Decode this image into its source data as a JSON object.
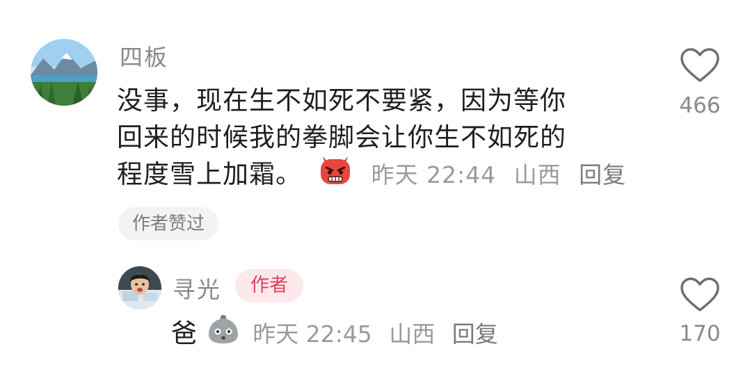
{
  "comment": {
    "username": "四板",
    "lines": [
      "没事，现在生不如死不要紧，因为等你",
      "回来的时候我的拳脚会让你生不如死的",
      "程度雪上加霜。"
    ],
    "emoji_icon": "angry-devil-emoji-icon",
    "time": "昨天 22:44",
    "location": "山西",
    "reply_label": "回复",
    "liked_badge": "作者赞过",
    "like_count": "466"
  },
  "reply": {
    "username": "寻光",
    "author_tag": "作者",
    "text": "爸",
    "emoji_icon": "grey-blob-emoji-icon",
    "time": "昨天 22:45",
    "location": "山西",
    "reply_label": "回复",
    "like_count": "170"
  },
  "colors": {
    "username": "#8a8a8a",
    "meta": "#9a9a9a",
    "author_tag_bg": "#fde9ec",
    "author_tag_text": "#e0415b",
    "badge_bg": "#f3f3f3"
  }
}
